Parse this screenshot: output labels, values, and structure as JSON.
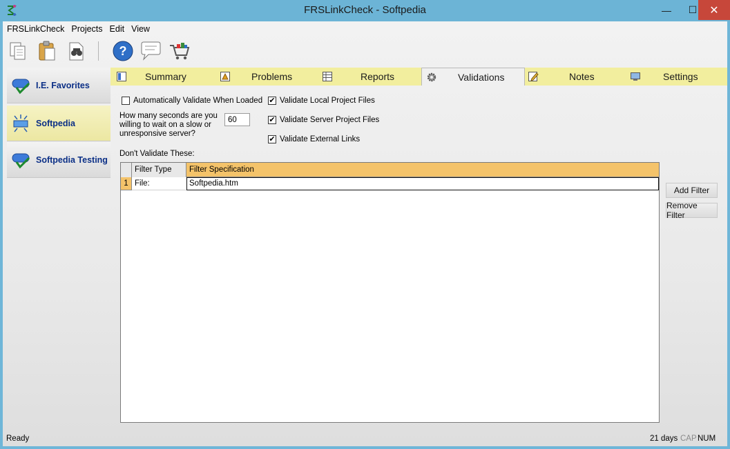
{
  "window": {
    "title": "FRSLinkCheck - Softpedia",
    "minimize_glyph": "—",
    "maximize_glyph": "☐",
    "close_glyph": "✕"
  },
  "menu": [
    "FRSLinkCheck",
    "Projects",
    "Edit",
    "View"
  ],
  "toolbar": {
    "icons": [
      "copy-icon",
      "paste-icon",
      "find-icon",
      "help-icon",
      "feedback-icon",
      "cart-icon"
    ]
  },
  "sidebar": {
    "items": [
      {
        "label": "I.E. Favorites",
        "icon": "checkmark-drive-icon"
      },
      {
        "label": "Softpedia",
        "icon": "broken-link-icon"
      },
      {
        "label": "Softpedia Testing",
        "icon": "checkmark-drive-icon"
      }
    ]
  },
  "tabs": [
    {
      "label": "Summary",
      "icon": "summary-icon"
    },
    {
      "label": "Problems",
      "icon": "problems-icon"
    },
    {
      "label": "Reports",
      "icon": "reports-icon"
    },
    {
      "label": "Validations",
      "icon": "gear-icon",
      "active": true
    },
    {
      "label": "Notes",
      "icon": "notes-icon"
    },
    {
      "label": "Settings",
      "icon": "settings-icon"
    }
  ],
  "validations": {
    "auto_validate": {
      "label": "Automatically Validate When Loaded",
      "checked": false
    },
    "timeout_prompt": "How many seconds are you willing to wait on a slow or unresponsive server?",
    "timeout_value": "60",
    "validate_local": {
      "label": "Validate Local Project Files",
      "checked": true
    },
    "validate_server": {
      "label": "Validate Server Project Files",
      "checked": true
    },
    "validate_external": {
      "label": "Validate External Links",
      "checked": true
    },
    "dont_validate_label": "Don't Validate These:",
    "grid": {
      "columns": [
        "Filter Type",
        "Filter Specification"
      ],
      "rows": [
        {
          "num": "1",
          "type": "File:",
          "spec": "Softpedia.htm"
        }
      ]
    },
    "add_filter": "Add Filter",
    "remove_filter": "Remove Filter"
  },
  "status": {
    "text": "Ready",
    "days": "21 days",
    "cap": "CAP",
    "num": "NUM"
  },
  "colors": {
    "titlebar": "#6cb4d6",
    "tabstrip": "#f2ee9e",
    "grid_header": "#f4c36a",
    "selected_nav": "#ece7a2",
    "close_button": "#c7473a"
  }
}
